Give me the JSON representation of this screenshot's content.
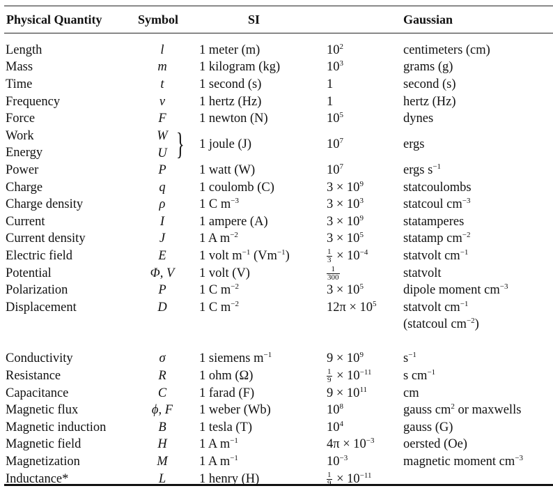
{
  "header": {
    "quantity": "Physical Quantity",
    "symbol": "Symbol",
    "si": "SI",
    "gaussian": "Gaussian"
  },
  "rows": [
    {
      "quantity": "Length",
      "symbol": "l",
      "si": "1 meter (m)",
      "factor": "10^2",
      "gaussian": "centimeters (cm)"
    },
    {
      "quantity": "Mass",
      "symbol": "m",
      "si": "1 kilogram (kg)",
      "factor": "10^3",
      "gaussian": "grams (g)"
    },
    {
      "quantity": "Time",
      "symbol": "t",
      "si": "1 second (s)",
      "factor": "1",
      "gaussian": "second (s)"
    },
    {
      "quantity": "Frequency",
      "symbol": "ν",
      "si": "1 hertz (Hz)",
      "factor": "1",
      "gaussian": "hertz (Hz)"
    },
    {
      "quantity": "Force",
      "symbol": "F",
      "si": "1 newton (N)",
      "factor": "10^5",
      "gaussian": "dynes"
    },
    {
      "quantity": "Work",
      "symbol": "W",
      "si": "1 joule (J)",
      "factor": "10^7",
      "gaussian": "ergs"
    },
    {
      "quantity": "Energy",
      "symbol": "U"
    },
    {
      "quantity": "Power",
      "symbol": "P",
      "si": "1 watt (W)",
      "factor": "10^7",
      "gaussian": "ergs s^-1"
    },
    {
      "quantity": "Charge",
      "symbol": "q",
      "si": "1 coulomb (C)",
      "factor": "3 × 10^9",
      "gaussian": "statcoulombs"
    },
    {
      "quantity": "Charge density",
      "symbol": "ρ",
      "si": "1 C m^-3",
      "factor": "3 × 10^3",
      "gaussian": "statcoul cm^-3"
    },
    {
      "quantity": "Current",
      "symbol": "I",
      "si": "1 ampere (A)",
      "factor": "3 × 10^9",
      "gaussian": "statamperes"
    },
    {
      "quantity": "Current density",
      "symbol": "J",
      "si": "1 A m^-2",
      "factor": "3 × 10^5",
      "gaussian": "statamp cm^-2"
    },
    {
      "quantity": "Electric field",
      "symbol": "E",
      "si": "1 volt m^-1 (Vm^-1)",
      "factor": "1/3 × 10^-4",
      "gaussian": "statvolt cm^-1"
    },
    {
      "quantity": "Potential",
      "symbol": "Φ, V",
      "si": "1 volt (V)",
      "factor": "1/300",
      "gaussian": "statvolt"
    },
    {
      "quantity": "Polarization",
      "symbol": "P",
      "si": "1 C m^-2",
      "factor": "3 × 10^5",
      "gaussian": "dipole moment cm^-3"
    },
    {
      "quantity": "Displacement",
      "symbol": "D",
      "si": "1 C m^-2",
      "factor": "12π × 10^5",
      "gaussian": "statvolt cm^-1",
      "gaussian2": "(statcoul cm^-2)"
    },
    {
      "quantity": "Conductivity",
      "symbol": "σ",
      "si": "1 siemens m^-1",
      "factor": "9 × 10^9",
      "gaussian": "s^-1"
    },
    {
      "quantity": "Resistance",
      "symbol": "R",
      "si": "1 ohm (Ω)",
      "factor": "1/9 × 10^-11",
      "gaussian": "s cm^-1"
    },
    {
      "quantity": "Capacitance",
      "symbol": "C",
      "si": "1 farad (F)",
      "factor": "9 × 10^11",
      "gaussian": "cm"
    },
    {
      "quantity": "Magnetic flux",
      "symbol": "ϕ, F",
      "si": "1 weber (Wb)",
      "factor": "10^8",
      "gaussian": "gauss cm^2 or maxwells"
    },
    {
      "quantity": "Magnetic induction",
      "symbol": "B",
      "si": "1 tesla (T)",
      "factor": "10^4",
      "gaussian": "gauss (G)"
    },
    {
      "quantity": "Magnetic field",
      "symbol": "H",
      "si": "1 A m^-1",
      "factor": "4π × 10^-3",
      "gaussian": "oersted (Oe)"
    },
    {
      "quantity": "Magnetization",
      "symbol": "M",
      "si": "1 A m^-1",
      "factor": "10^-3",
      "gaussian": "magnetic moment cm^-3"
    },
    {
      "quantity": "Inductance*",
      "symbol": "L",
      "si": "1 henry (H)",
      "factor": "1/9 × 10^-11",
      "gaussian": ""
    }
  ]
}
